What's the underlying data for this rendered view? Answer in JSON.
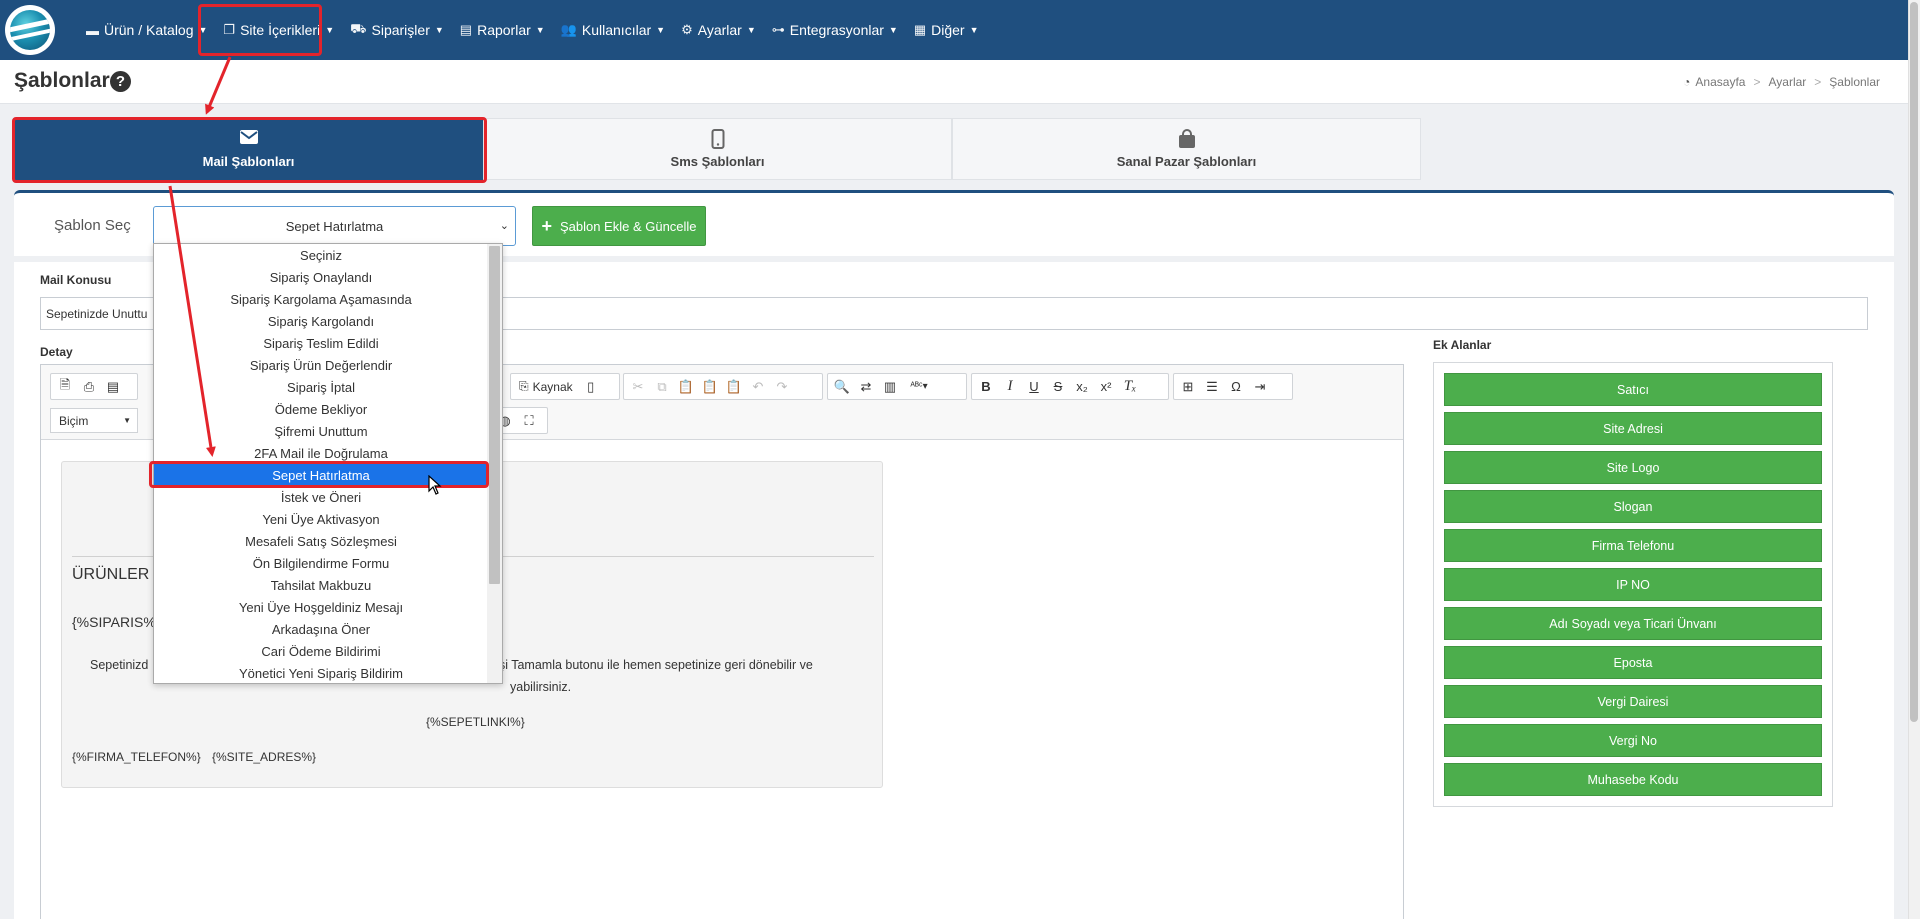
{
  "nav": {
    "items": [
      {
        "icon": "catalog-icon",
        "label": "Ürün / Katalog"
      },
      {
        "icon": "copy-icon",
        "label": "Site İçerikleri"
      },
      {
        "icon": "truck-icon",
        "label": "Siparişler"
      },
      {
        "icon": "report-icon",
        "label": "Raporlar"
      },
      {
        "icon": "users-icon",
        "label": "Kullanıcılar"
      },
      {
        "icon": "cogs-icon",
        "label": "Ayarlar"
      },
      {
        "icon": "sitemap-icon",
        "label": "Entegrasyonlar"
      },
      {
        "icon": "grid-icon",
        "label": "Diğer"
      }
    ]
  },
  "page": {
    "title": "Şablonlar",
    "breadcrumb": [
      "Anasayfa",
      "Ayarlar",
      "Şablonlar"
    ]
  },
  "tabs": [
    {
      "label": "Mail Şablonları",
      "icon": "envelope-icon",
      "active": true
    },
    {
      "label": "Sms Şablonları",
      "icon": "mobile-icon",
      "active": false
    },
    {
      "label": "Sanal Pazar Şablonları",
      "icon": "shopping-bag-icon",
      "active": false
    }
  ],
  "template_select": {
    "label": "Şablon Seç",
    "value": "Sepet Hatırlatma",
    "add_button": "Şablon Ekle & Güncelle",
    "options": [
      "Seçiniz",
      "Sipariş Onaylandı",
      "Sipariş Kargolama Aşamasında",
      "Sipariş Kargolandı",
      "Sipariş Teslim Edildi",
      "Sipariş Ürün Değerlendir",
      "Sipariş İptal",
      "Ödeme Bekliyor",
      "Şifremi Unuttum",
      "2FA Mail ile Doğrulama",
      "Sepet Hatırlatma",
      "İstek ve Öneri",
      "Yeni Üye Aktivasyon",
      "Mesafeli Satış Sözleşmesi",
      "Ön Bilgilendirme Formu",
      "Tahsilat Makbuzu",
      "Yeni Üye Hoşgeldiniz Mesajı",
      "Arkadaşına Öner",
      "Cari Ödeme Bildirimi",
      "Yönetici Yeni Sipariş Bildirim"
    ],
    "selected_index": 10
  },
  "form": {
    "subject_label": "Mail Konusu",
    "subject_value": "Sepetinizde Unuttu",
    "detail_label": "Detay"
  },
  "editor": {
    "source_label": "Kaynak",
    "format_label": "Biçim",
    "content": {
      "placeholder_1": "%}",
      "placeholder_2": "}",
      "products_heading": "ÜRÜNLER",
      "siparis_token": "{%SIPARIS%",
      "body_line_1_start": "Sepetinizd",
      "body_line_1_end": "rişi Tamamla butonu ile hemen sepetinize geri dönebilir ve",
      "body_line_2": "yabilirsiniz.",
      "cart_link": "{%SEPETLINKI%}",
      "footer_phone": "{%FIRMA_TELEFON%}",
      "footer_address": "{%SITE_ADRES%}"
    }
  },
  "extra_fields": {
    "title": "Ek Alanlar",
    "buttons": [
      "Satıcı",
      "Site Adresi",
      "Site Logo",
      "Slogan",
      "Firma Telefonu",
      "IP NO",
      "Adı Soyadı veya Ticari Ünvanı",
      "Eposta",
      "Vergi Dairesi",
      "Vergi No",
      "Muhasebe Kodu"
    ]
  },
  "colors": {
    "nav_bg": "#1f4f7f",
    "accent_green": "#4cae4c",
    "highlight_red": "#e3242b",
    "selection_blue": "#1a73e8"
  }
}
